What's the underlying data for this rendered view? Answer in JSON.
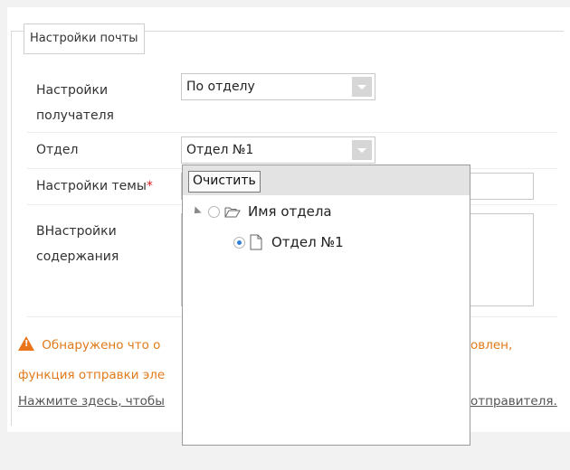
{
  "section_title": "Настройки почты",
  "fields": {
    "recipient_label": "Настройки получателя",
    "recipient_value": "По отделу",
    "department_label": "Отдел",
    "department_value": "Отдел №1",
    "subject_label": "Настройки темы",
    "subject_required_mark": "*",
    "content_label": "ВНастройки содержания"
  },
  "warning": {
    "line1_left": "Обнаружено что о",
    "line1_right": "овлен,",
    "line2": "функция отправки эле",
    "link_left": "Нажмите здесь, чтобы",
    "link_right": "отправителя."
  },
  "dropdown": {
    "clear_label": "Очистить",
    "tree": [
      {
        "label": "Имя отдела",
        "type": "folder",
        "selected": false,
        "expanded": true
      },
      {
        "label": "Отдел №1",
        "type": "document",
        "selected": true
      }
    ]
  },
  "colors": {
    "warning": "#e07a1a",
    "required": "#d21f1f",
    "radio_selected": "#2f7fd7"
  }
}
